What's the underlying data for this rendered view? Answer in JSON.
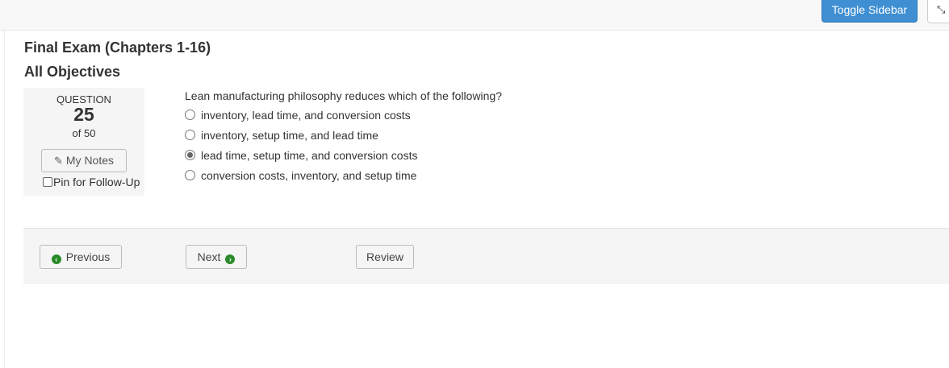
{
  "header": {
    "toggle_sidebar_label": "Toggle Sidebar",
    "expand_icon": "compress-icon"
  },
  "exam": {
    "title": "Final Exam (Chapters 1-16)",
    "objective": "All Objectives"
  },
  "question_panel": {
    "label": "QUESTION",
    "number": "25",
    "total": "of 50",
    "notes_label": "My Notes",
    "notes_icon": "edit-icon",
    "pin_label": "Pin for Follow-Up",
    "pin_checked": false
  },
  "question": {
    "text": "Lean manufacturing philosophy reduces which of the following?",
    "options": [
      {
        "label": "inventory, lead time, and conversion costs",
        "selected": false
      },
      {
        "label": "inventory, setup time, and lead time",
        "selected": false
      },
      {
        "label": "lead time, setup time, and conversion costs",
        "selected": true
      },
      {
        "label": "conversion costs, inventory, and setup time",
        "selected": false
      }
    ]
  },
  "navigation": {
    "previous_label": "Previous",
    "next_label": "Next",
    "review_label": "Review"
  },
  "colors": {
    "primary": "#3f8fd2",
    "nav_icon": "#2a8a2a",
    "panel_bg": "#f5f5f5"
  }
}
